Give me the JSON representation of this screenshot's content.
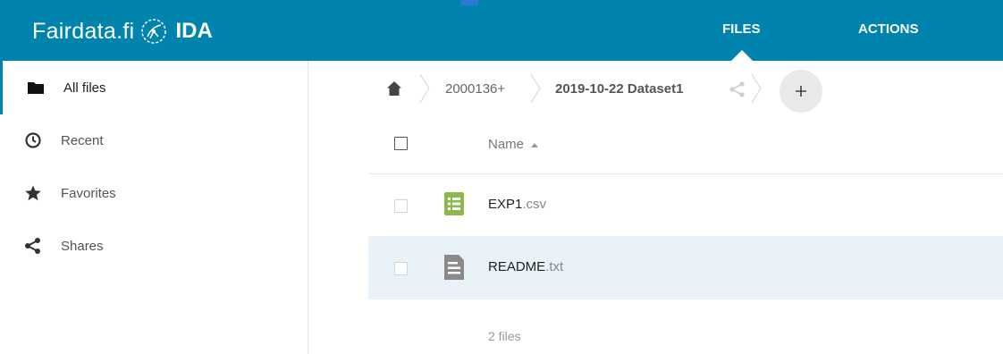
{
  "header": {
    "logo_text": "Fairdata.fi",
    "logo_product": "IDA",
    "nav": {
      "files": "FILES",
      "actions": "ACTIONS"
    }
  },
  "sidebar": {
    "items": [
      {
        "label": "All files",
        "icon": "folder-icon",
        "active": true
      },
      {
        "label": "Recent",
        "icon": "clock-icon"
      },
      {
        "label": "Favorites",
        "icon": "star-icon"
      },
      {
        "label": "Shares",
        "icon": "share-icon"
      }
    ]
  },
  "breadcrumb": {
    "items": [
      {
        "label": "2000136+"
      },
      {
        "label": "2019-10-22 Dataset1"
      }
    ],
    "add_label": "+"
  },
  "table": {
    "columns": {
      "name": "Name"
    },
    "rows": [
      {
        "name": "EXP1",
        "ext": ".csv",
        "icon": "spreadsheet-icon",
        "icon_color": "#8bb94b",
        "selected": false
      },
      {
        "name": "README",
        "ext": ".txt",
        "icon": "text-file-icon",
        "icon_color": "#8a8a8a",
        "selected": true
      }
    ],
    "summary": "2 files"
  },
  "colors": {
    "header_bg": "#0083ad",
    "selected_row_bg": "#e8f2f7"
  }
}
